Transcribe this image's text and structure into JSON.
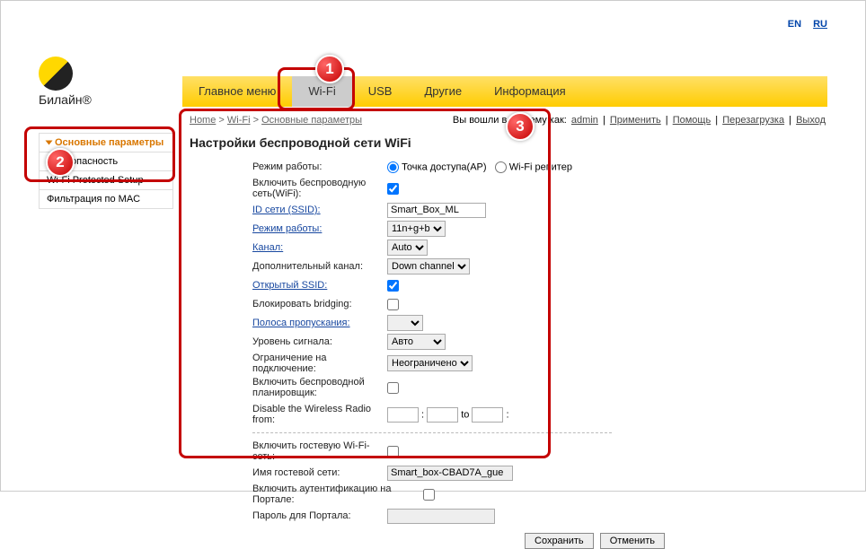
{
  "lang": {
    "en": "EN",
    "ru": "RU"
  },
  "logo": {
    "text": "Билайн®"
  },
  "nav": {
    "items": [
      "Главное меню",
      "Wi-Fi",
      "USB",
      "Другие",
      "Информация"
    ],
    "active": 1
  },
  "userbar": {
    "prefix": "Вы вошли в систему как:",
    "user": "admin",
    "links": [
      "Применить",
      "Помощь",
      "Перезагрузка",
      "Выход"
    ]
  },
  "breadcrumb": {
    "home": "Home",
    "sep": " > ",
    "wifi": "Wi-Fi",
    "current": "Основные параметры"
  },
  "sidebar": {
    "items": [
      {
        "label": "Основные параметры",
        "active": true
      },
      {
        "label": "Безопасность",
        "active": false
      },
      {
        "label": "Wi-Fi Protected Setup",
        "active": false
      },
      {
        "label": "Фильтрация по MAC",
        "active": false
      }
    ]
  },
  "page_title": "Настройки беспроводной сети WiFi",
  "form": {
    "mode_label": "Режим работы:",
    "mode_ap": "Точка доступа(AP)",
    "mode_repeater": "Wi-Fi репитер",
    "enable_wifi_label": "Включить беспроводную сеть(WiFi):",
    "enable_wifi": true,
    "ssid_label": "ID сети (SSID):",
    "ssid": "Smart_Box_ML",
    "wmode_label": "Режим работы:",
    "wmode": "11n+g+b",
    "channel_label": "Канал:",
    "channel": "Auto",
    "ext_channel_label": "Дополнительный канал:",
    "ext_channel": "Down channel",
    "open_ssid_label": "Открытый SSID:",
    "open_ssid": true,
    "block_bridging_label": "Блокировать bridging:",
    "block_bridging": false,
    "bandwidth_label": "Полоса пропускания:",
    "bandwidth": "",
    "signal_label": "Уровень сигнала:",
    "signal": "Авто",
    "conn_limit_label": "Ограничение на подключение:",
    "conn_limit": "Неограничено",
    "scheduler_label": "Включить беспроводной планировщик:",
    "scheduler": false,
    "disable_radio_label": "Disable the Wireless Radio from:",
    "time_to": "to",
    "guest_enable_label": "Включить гостевую Wi-Fi-сеть:",
    "guest_enable": false,
    "guest_name_label": "Имя гостевой сети:",
    "guest_name": "Smart_box-CBAD7A_gue",
    "portal_auth_label": "Включить аутентификацию на Портале:",
    "portal_auth": false,
    "portal_pwd_label": "Пароль для Портала:",
    "portal_pwd": ""
  },
  "buttons": {
    "save": "Сохранить",
    "cancel": "Отменить"
  },
  "badges": {
    "b1": "1",
    "b2": "2",
    "b3": "3"
  }
}
